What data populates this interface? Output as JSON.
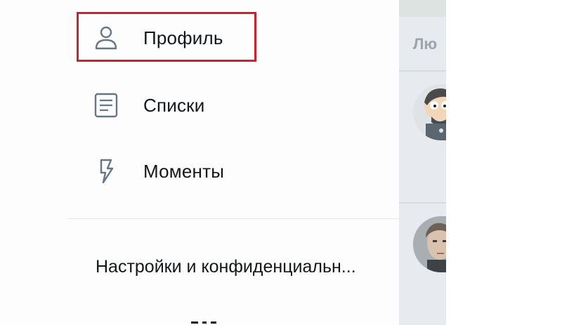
{
  "drawer": {
    "menu": [
      {
        "id": "profile",
        "label": "Профиль",
        "icon": "person-icon"
      },
      {
        "id": "lists",
        "label": "Списки",
        "icon": "list-document-icon"
      },
      {
        "id": "moments",
        "label": "Моменты",
        "icon": "lightning-bolt-icon"
      }
    ],
    "settings_label": "Настройки и конфиденциальн..."
  },
  "timeline": {
    "header_partial": "Лю"
  },
  "colors": {
    "highlight": "#d0202d",
    "icon": "#657786",
    "text": "#14171a",
    "timeline_bg": "#e7eaee",
    "timeline_header": "#9aa4ad"
  }
}
